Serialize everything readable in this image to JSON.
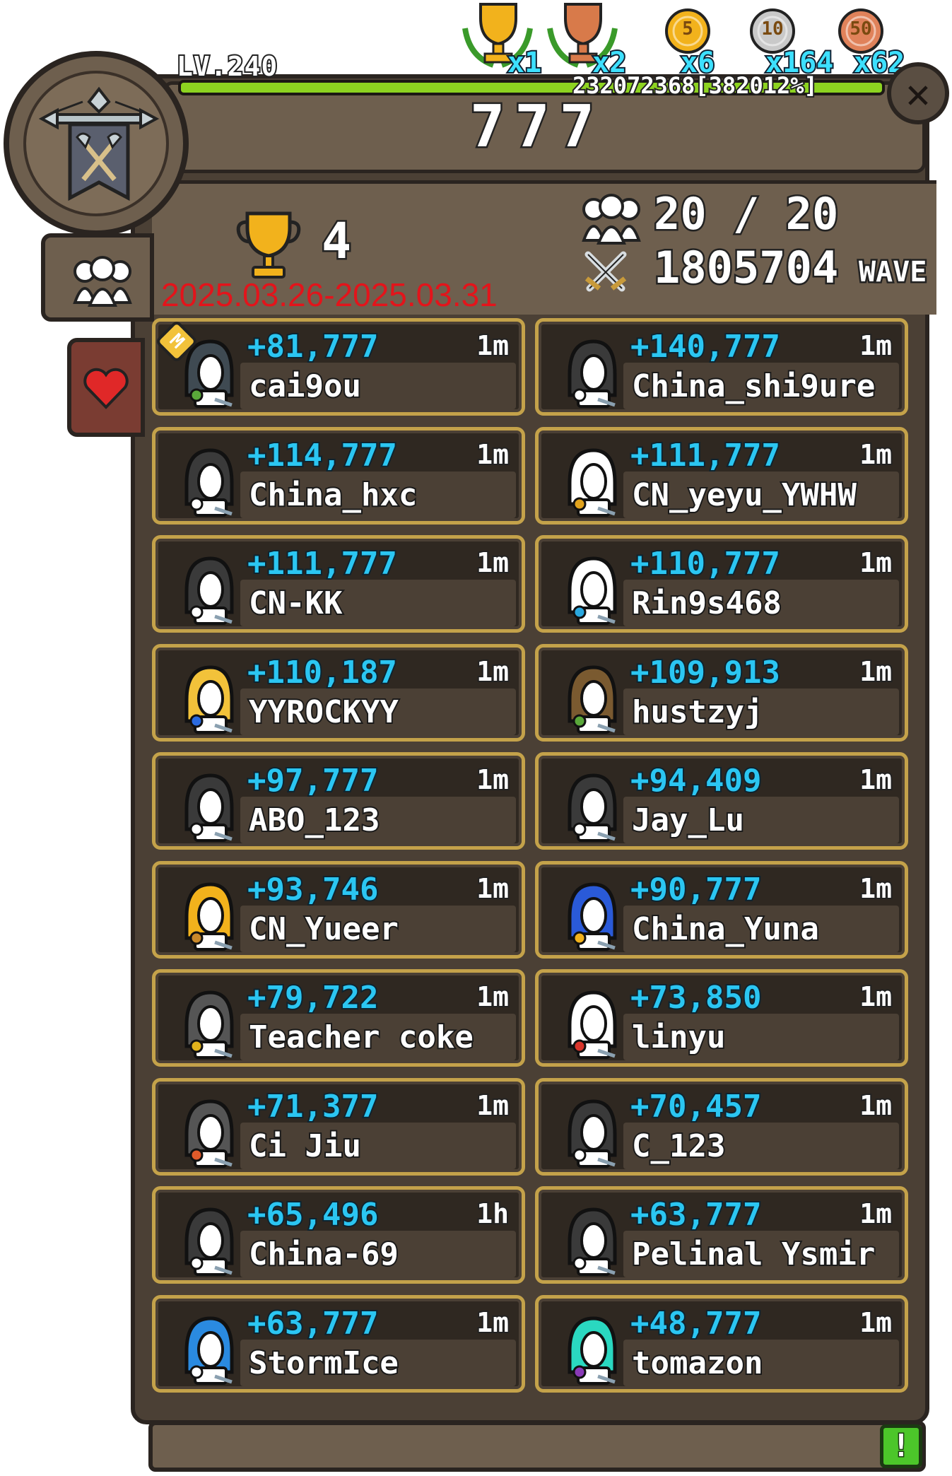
{
  "player": {
    "level_label": "LV.240",
    "xp_text": "232072368[382012%]",
    "xp_fraction": 1.0
  },
  "medals": [
    {
      "icon": "gold-trophy-icon",
      "count": "x1",
      "color": "#f2b21c"
    },
    {
      "icon": "bronze-trophy-icon",
      "count": "x2",
      "color": "#d87a4a"
    },
    {
      "icon": "gold-coin-5-icon",
      "count": "x6",
      "color": "#f2b21c",
      "label": "5"
    },
    {
      "icon": "silver-coin-10-icon",
      "count": "x164",
      "color": "#c9c9c9",
      "label": "10"
    },
    {
      "icon": "bronze-coin-50-icon",
      "count": "x62",
      "color": "#e0825a",
      "label": "50"
    }
  ],
  "guild": {
    "name": "777",
    "rank": "4",
    "date_range": "2025.03.26-2025.03.31",
    "members_count": "20 / 20",
    "wave": "1805704",
    "wave_label": "WAVE"
  },
  "members": [
    {
      "score": "+81,777",
      "time": "1m",
      "name": "cai9ou",
      "avatar": "wolf-mage-avatar",
      "badge": "M"
    },
    {
      "score": "+140,777",
      "time": "1m",
      "name": "China_shi9ure",
      "avatar": "hooded-knight-avatar"
    },
    {
      "score": "+114,777",
      "time": "1m",
      "name": "China_hxc",
      "avatar": "hooded-knight-avatar"
    },
    {
      "score": "+111,777",
      "time": "1m",
      "name": "CN_yeyu_YWHW",
      "avatar": "clock-mage-avatar"
    },
    {
      "score": "+111,777",
      "time": "1m",
      "name": "CN-KK",
      "avatar": "hooded-knight-avatar"
    },
    {
      "score": "+110,777",
      "time": "1m",
      "name": "Rin9s468",
      "avatar": "white-hood-avatar"
    },
    {
      "score": "+110,187",
      "time": "1m",
      "name": "YYROCKYY",
      "avatar": "valkyrie-avatar"
    },
    {
      "score": "+109,913",
      "time": "1m",
      "name": "hustzyj",
      "avatar": "beast-mage-avatar"
    },
    {
      "score": "+97,777",
      "time": "1m",
      "name": "ABO_123",
      "avatar": "hooded-knight-avatar"
    },
    {
      "score": "+94,409",
      "time": "1m",
      "name": "Jay_Lu",
      "avatar": "hooded-knight-avatar"
    },
    {
      "score": "+93,746",
      "time": "1m",
      "name": "CN_Yueer",
      "avatar": "elf-archer-avatar"
    },
    {
      "score": "+90,777",
      "time": "1m",
      "name": "China_Yuna",
      "avatar": "blue-witch-avatar"
    },
    {
      "score": "+79,722",
      "time": "1m",
      "name": "Teacher coke",
      "avatar": "skeleton-king-avatar"
    },
    {
      "score": "+73,850",
      "time": "1m",
      "name": "linyu",
      "avatar": "red-hood-avatar"
    },
    {
      "score": "+71,377",
      "time": "1m",
      "name": "Ci Jiu",
      "avatar": "grey-witch-rider-avatar"
    },
    {
      "score": "+70,457",
      "time": "1m",
      "name": "C_123",
      "avatar": "hooded-knight-avatar"
    },
    {
      "score": "+65,496",
      "time": "1h",
      "name": "China-69",
      "avatar": "hooded-knight-avatar"
    },
    {
      "score": "+63,777",
      "time": "1m",
      "name": "Pelinal Ysmir",
      "avatar": "hooded-knight-avatar"
    },
    {
      "score": "+63,777",
      "time": "1m",
      "name": "StormIce",
      "avatar": "blue-wizard-avatar"
    },
    {
      "score": "+48,777",
      "time": "1m",
      "name": "tomazon",
      "avatar": "teal-demon-avatar"
    }
  ],
  "buttons": {
    "close": "✕",
    "alert": "!"
  }
}
